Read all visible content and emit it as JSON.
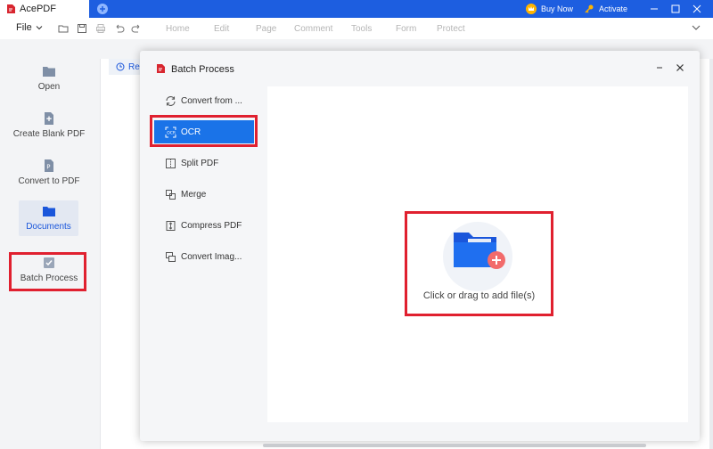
{
  "app": {
    "name": "AcePDF"
  },
  "titlebar": {
    "buy_label": "Buy Now",
    "activate_label": "Activate"
  },
  "toolbar": {
    "file_label": "File",
    "menus": [
      "Home",
      "Edit",
      "Page",
      "Comment",
      "Tools",
      "Form",
      "Protect"
    ]
  },
  "sidebar": {
    "items": [
      {
        "label": "Open",
        "icon": "folder-icon"
      },
      {
        "label": "Create Blank PDF",
        "icon": "add-file-icon"
      },
      {
        "label": "Convert to PDF",
        "icon": "convert-file-icon"
      },
      {
        "label": "Documents",
        "icon": "documents-icon"
      },
      {
        "label": "Batch Process",
        "icon": "batch-process-icon"
      }
    ]
  },
  "recent": {
    "label": "Re"
  },
  "dialog": {
    "title": "Batch Process",
    "menu": [
      {
        "label": "Convert from ...",
        "icon": "convert-icon"
      },
      {
        "label": "OCR",
        "icon": "ocr-icon"
      },
      {
        "label": "Split PDF",
        "icon": "split-icon"
      },
      {
        "label": "Merge",
        "icon": "merge-icon"
      },
      {
        "label": "Compress PDF",
        "icon": "compress-icon"
      },
      {
        "label": "Convert Imag...",
        "icon": "convert-image-icon"
      }
    ],
    "active_item": "OCR",
    "drop_text": "Click or drag to add file(s)"
  },
  "colors": {
    "titlebar": "#1d5ee0",
    "accent": "#1a73e8",
    "highlight": "#e0202f"
  }
}
